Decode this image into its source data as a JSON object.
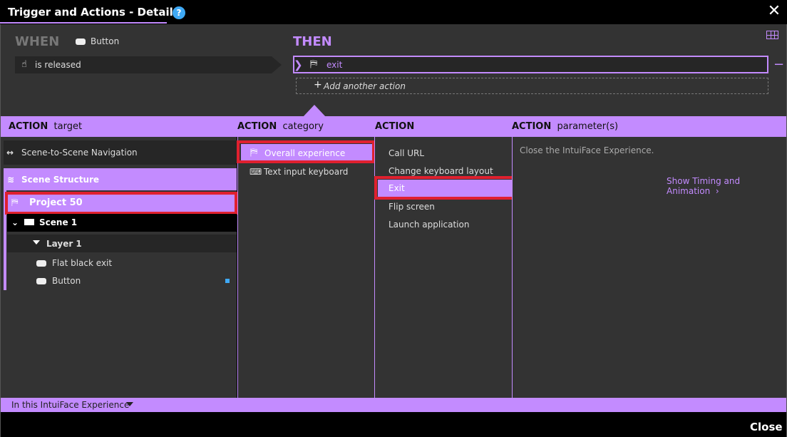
{
  "window": {
    "title": "Trigger and Actions - Details",
    "close_label": "Close"
  },
  "when": {
    "label": "WHEN",
    "object": "Button",
    "trigger": "is released"
  },
  "then": {
    "label": "THEN",
    "action": "exit",
    "add_action": "Add another action"
  },
  "columns": {
    "target": {
      "label": "ACTION",
      "suffix": "target"
    },
    "category": {
      "label": "ACTION",
      "suffix": "category"
    },
    "action": {
      "label": "ACTION",
      "suffix": ""
    },
    "params": {
      "label": "ACTION",
      "suffix": "parameter(s)"
    }
  },
  "target": {
    "nav": "Scene-to-Scene Navigation",
    "structure": "Scene Structure",
    "project": "Project 50",
    "scene": "Scene 1",
    "layer": "Layer 1",
    "items": [
      "Flat black exit",
      "Button"
    ]
  },
  "category": {
    "items": [
      "Overall experience",
      "Text input keyboard"
    ],
    "selected_index": 0
  },
  "action": {
    "items": [
      "Call URL",
      "Change keyboard layout",
      "Exit",
      "Flip screen",
      "Launch application"
    ],
    "selected_index": 2
  },
  "params": {
    "description": "Close the IntuiFace Experience.",
    "timing_link": "Show Timing and Animation"
  },
  "footer": {
    "scope": "In this IntuiFace Experience"
  },
  "colors": {
    "accent": "#c38bff",
    "highlight": "#e0202f",
    "help": "#3fa9f5"
  }
}
